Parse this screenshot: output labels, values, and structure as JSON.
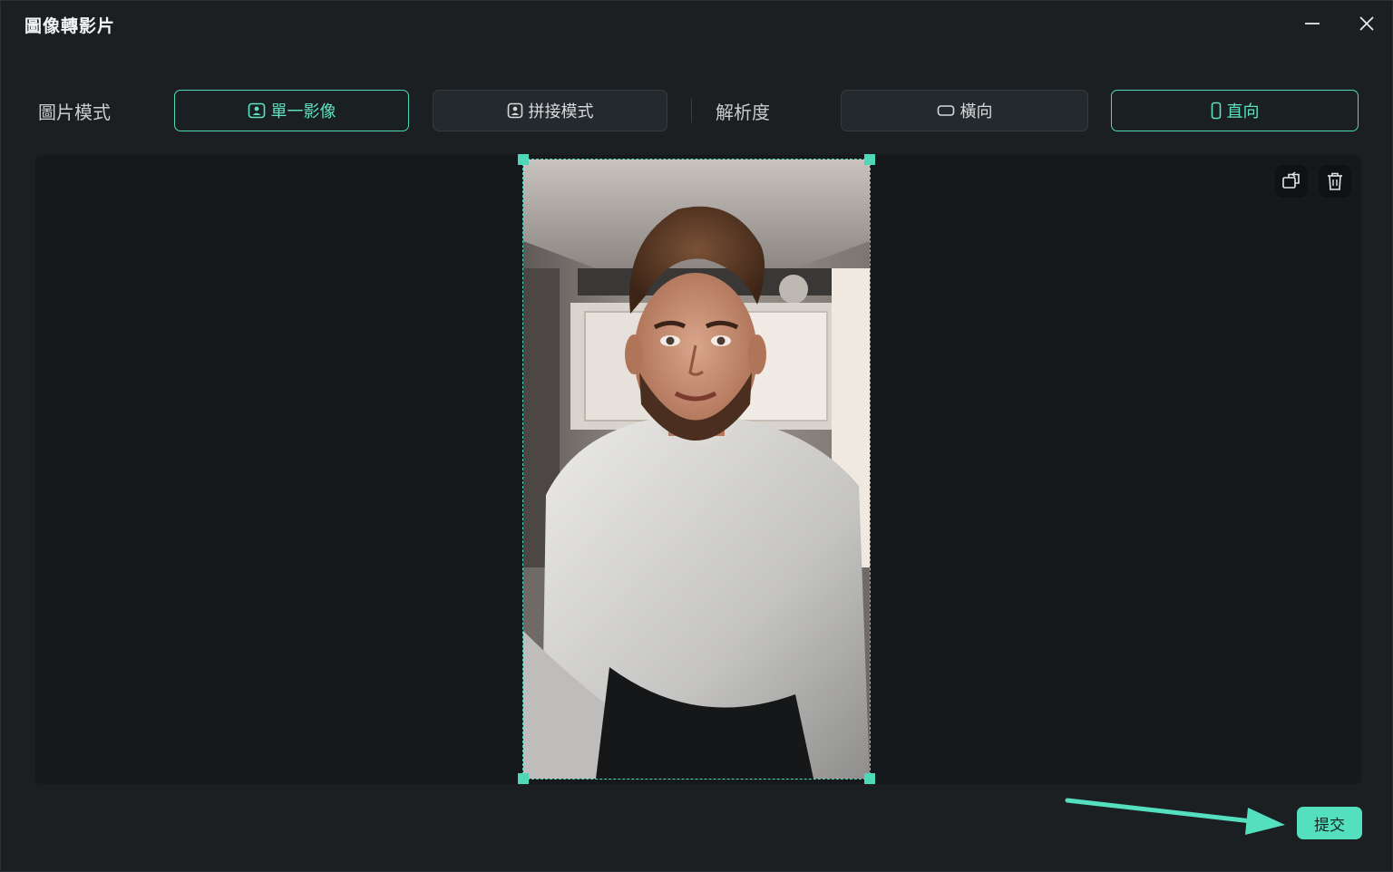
{
  "window": {
    "title": "圖像轉影片"
  },
  "toolbar": {
    "mode_label": "圖片模式",
    "single_label": "單一影像",
    "collage_label": "拼接模式",
    "resolution_label": "解析度",
    "landscape_label": "橫向",
    "portrait_label": "直向",
    "selected_mode": "單一影像",
    "selected_orientation": "直向"
  },
  "canvas": {
    "image_subject": "portrait photo of a smiling bearded man in a light grey sweater"
  },
  "footer": {
    "submit_label": "提交"
  },
  "colors": {
    "accent": "#4fd8b8",
    "background": "#1b1f22",
    "canvas": "#16191c"
  },
  "icons": {
    "minimize": "minimize-icon",
    "close": "close-icon",
    "single_image": "portrait-frame-icon",
    "collage": "portrait-frame-icon",
    "landscape": "landscape-rect-icon",
    "portrait": "portrait-rect-icon",
    "replace": "replace-image-icon",
    "delete": "trash-icon"
  }
}
